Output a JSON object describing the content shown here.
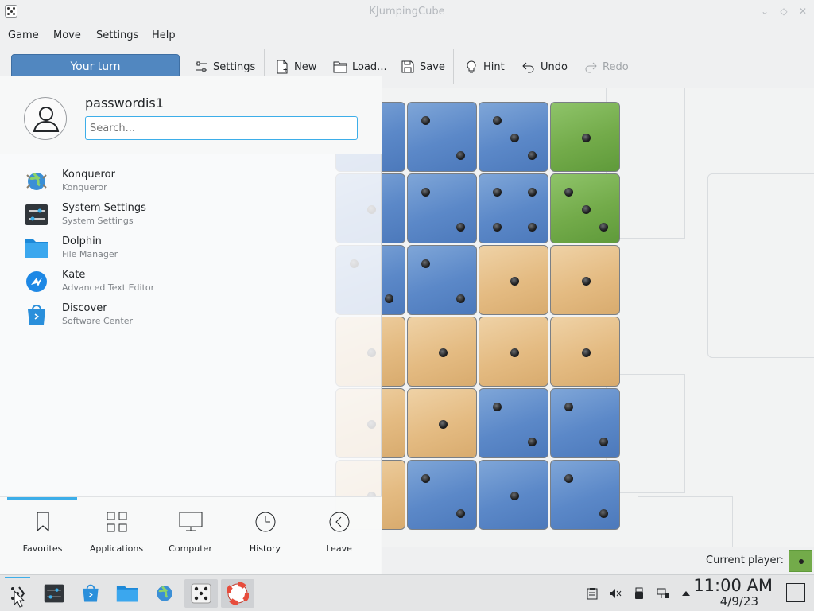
{
  "window": {
    "title": "KJumpingCube",
    "controls": [
      "minimize",
      "maximize",
      "close"
    ]
  },
  "menubar": {
    "items": [
      "Game",
      "Move",
      "Settings",
      "Help"
    ]
  },
  "toolbar": {
    "turn_label": "Your turn",
    "settings": "Settings",
    "new": "New",
    "load": "Load...",
    "save": "Save",
    "hint": "Hint",
    "undo": "Undo",
    "redo": "Redo"
  },
  "board": {
    "colors": {
      "blue": "#5b88c8",
      "green": "#73ab4a",
      "orange": "#e4bb82"
    },
    "visible_cells": [
      [
        {
          "c": "blue",
          "n": 1
        },
        {
          "c": "blue",
          "n": 2
        },
        {
          "c": "blue",
          "n": 3
        },
        {
          "c": "green",
          "n": 1
        }
      ],
      [
        {
          "c": "blue",
          "n": 1
        },
        {
          "c": "blue",
          "n": 2
        },
        {
          "c": "blue",
          "n": 4
        },
        {
          "c": "green",
          "n": 3
        }
      ],
      [
        {
          "c": "blue",
          "n": 2
        },
        {
          "c": "blue",
          "n": 2
        },
        {
          "c": "orange",
          "n": 1
        },
        {
          "c": "orange",
          "n": 1
        }
      ],
      [
        {
          "c": "orange",
          "n": 1
        },
        {
          "c": "orange",
          "n": 1
        },
        {
          "c": "orange",
          "n": 1
        },
        {
          "c": "orange",
          "n": 1
        }
      ],
      [
        {
          "c": "orange",
          "n": 1
        },
        {
          "c": "orange",
          "n": 1
        },
        {
          "c": "blue",
          "n": 2
        },
        {
          "c": "blue",
          "n": 2
        }
      ],
      [
        {
          "c": "orange",
          "n": 1
        },
        {
          "c": "blue",
          "n": 2
        },
        {
          "c": "blue",
          "n": 1
        },
        {
          "c": "blue",
          "n": 2
        }
      ]
    ]
  },
  "statusbar": {
    "current_player_label": "Current player:",
    "current_player_color": "#73ab4a"
  },
  "launcher": {
    "username": "passwordis1",
    "search_placeholder": "Search...",
    "favorites": [
      {
        "name": "Konqueror",
        "description": "Konqueror",
        "icon": "konqueror-icon"
      },
      {
        "name": "System Settings",
        "description": "System Settings",
        "icon": "system-settings-icon"
      },
      {
        "name": "Dolphin",
        "description": "File Manager",
        "icon": "dolphin-icon"
      },
      {
        "name": "Kate",
        "description": "Advanced Text Editor",
        "icon": "kate-icon"
      },
      {
        "name": "Discover",
        "description": "Software Center",
        "icon": "discover-icon"
      }
    ],
    "tabs": [
      {
        "label": "Favorites",
        "icon": "bookmark-icon",
        "active": true
      },
      {
        "label": "Applications",
        "icon": "grid-icon"
      },
      {
        "label": "Computer",
        "icon": "monitor-icon"
      },
      {
        "label": "History",
        "icon": "clock-icon"
      },
      {
        "label": "Leave",
        "icon": "leave-icon"
      }
    ]
  },
  "taskbar": {
    "apps": [
      "application-launcher",
      "system-settings",
      "discover",
      "dolphin",
      "konqueror",
      "kjumpingcube",
      "ksirk"
    ],
    "active_app": "kjumpingcube",
    "tray": [
      "clipboard-icon",
      "volume-muted-icon",
      "usb-icon",
      "network-icon",
      "expand-tray-icon"
    ],
    "time": "11:00 AM",
    "date": "4/9/23"
  }
}
